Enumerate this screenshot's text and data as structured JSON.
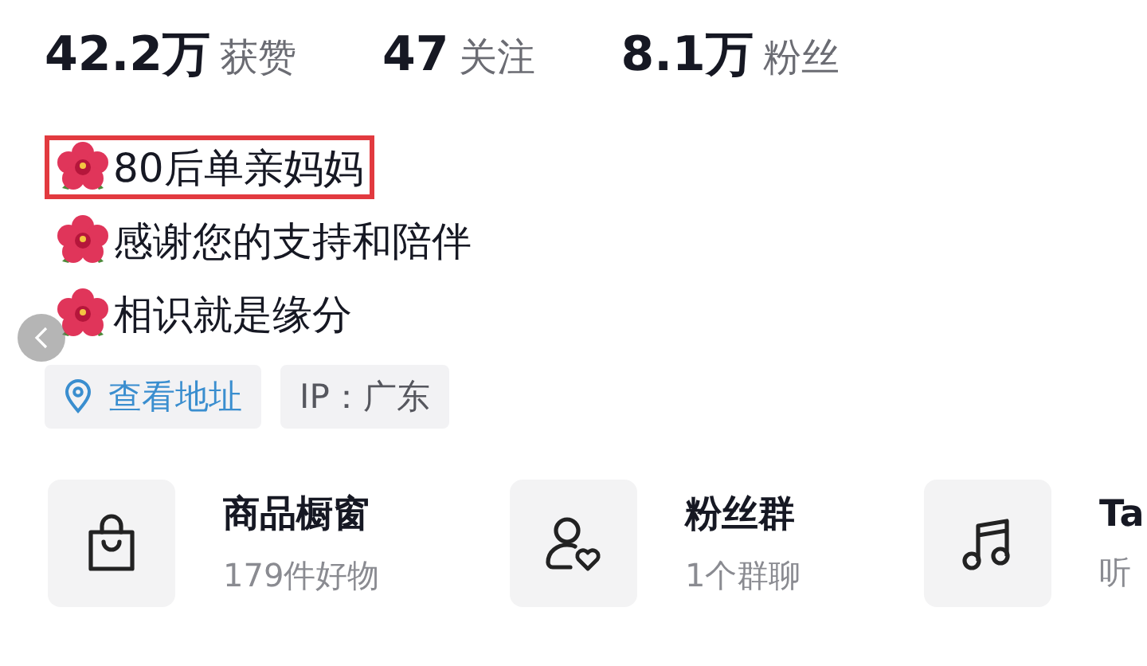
{
  "stats": [
    {
      "value": "42.2万",
      "label": "获赞"
    },
    {
      "value": "47",
      "label": "关注"
    },
    {
      "value": "8.1万",
      "label": "粉丝"
    }
  ],
  "bio": [
    {
      "text": "80后单亲妈妈",
      "highlighted": true
    },
    {
      "text": "感谢您的支持和陪伴",
      "highlighted": false
    },
    {
      "text": "相识就是缘分",
      "highlighted": false
    }
  ],
  "chips": [
    {
      "kind": "location",
      "label": "查看地址"
    },
    {
      "kind": "ip",
      "label": "IP：广东"
    }
  ],
  "cards": [
    {
      "kind": "shop",
      "title": "商品橱窗",
      "subtitle": "179件好物"
    },
    {
      "kind": "fans",
      "title": "粉丝群",
      "subtitle": "1个群聊"
    },
    {
      "kind": "music",
      "title": "Ta",
      "subtitle": "听"
    }
  ]
}
